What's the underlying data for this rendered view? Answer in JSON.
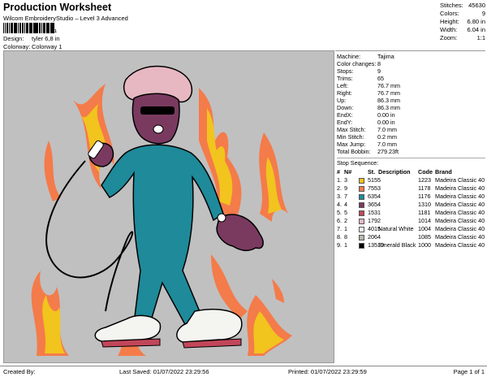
{
  "header": {
    "title": "Production Worksheet",
    "subtitle": "Wilcom EmbroideryStudio – Level 3 Advanced",
    "barcode_digit": "1",
    "design_label": "Design:",
    "design_value": "tyler 6,8 in",
    "colorway_label": "Colorway:",
    "colorway_value": "Colorway 1"
  },
  "top_stats": [
    {
      "label": "Stitches:",
      "value": "45630"
    },
    {
      "label": "Colors:",
      "value": "9"
    },
    {
      "label": "Height:",
      "value": "6.80 in"
    },
    {
      "label": "Width:",
      "value": "6.04 in"
    },
    {
      "label": "Zoom:",
      "value": "1:1"
    }
  ],
  "machine_info": [
    {
      "label": "Machine:",
      "value": "Tajima"
    },
    {
      "label": "Color changes:",
      "value": "8"
    },
    {
      "label": "Stops:",
      "value": "9"
    },
    {
      "label": "Trims:",
      "value": "65"
    },
    {
      "label": "Left:",
      "value": "76.7 mm"
    },
    {
      "label": "Right:",
      "value": "76.7 mm"
    },
    {
      "label": "Up:",
      "value": "86.3 mm"
    },
    {
      "label": "Down:",
      "value": "86.3 mm"
    },
    {
      "label": "EndX:",
      "value": "0.00 in"
    },
    {
      "label": "EndY:",
      "value": "0.00 in"
    },
    {
      "label": "Max Stitch:",
      "value": "7.0 mm"
    },
    {
      "label": "Min Stitch:",
      "value": "0.2 mm"
    },
    {
      "label": "Max Jump:",
      "value": "7.0 mm"
    },
    {
      "label": "Total Bobbin:",
      "value": "279.23ft"
    }
  ],
  "stop_sequence": {
    "title": "Stop Sequence:",
    "headers": {
      "stop": "#",
      "n": "N#",
      "st": "St.",
      "description": "Description",
      "code": "Code",
      "brand": "Brand"
    },
    "rows": [
      {
        "stop": "1.",
        "n": "3",
        "color": "#f2c41e",
        "st": "5155",
        "description": "",
        "code": "1223",
        "brand": "Madeira Classic 40"
      },
      {
        "stop": "2.",
        "n": "9",
        "color": "#f47b4a",
        "st": "7553",
        "description": "",
        "code": "1178",
        "brand": "Madeira Classic 40"
      },
      {
        "stop": "3.",
        "n": "7",
        "color": "#1e8a9a",
        "st": "6354",
        "description": "",
        "code": "1176",
        "brand": "Madeira Classic 40"
      },
      {
        "stop": "4.",
        "n": "4",
        "color": "#7a3a60",
        "st": "3654",
        "description": "",
        "code": "1310",
        "brand": "Madeira Classic 40"
      },
      {
        "stop": "5.",
        "n": "5",
        "color": "#c2465a",
        "st": "1531",
        "description": "",
        "code": "1181",
        "brand": "Madeira Classic 40"
      },
      {
        "stop": "6.",
        "n": "2",
        "color": "#e8b8c2",
        "st": "1792",
        "description": "",
        "code": "1014",
        "brand": "Madeira Classic 40"
      },
      {
        "stop": "7.",
        "n": "1",
        "color": "#f4f4f0",
        "st": "4015",
        "description": "Natural White",
        "code": "1004",
        "brand": "Madeira Classic 40"
      },
      {
        "stop": "8.",
        "n": "8",
        "color": "#b8b8b0",
        "st": "2064",
        "description": "",
        "code": "1085",
        "brand": "Madeira Classic 40"
      },
      {
        "stop": "9.",
        "n": "1",
        "color": "#000000",
        "st": "13510",
        "description": "Emerald Black",
        "code": "1000",
        "brand": "Madeira Classic 40"
      }
    ]
  },
  "footer": {
    "created_by": "Created By:",
    "last_saved": "Last Saved: 01/07/2022 23:29:56",
    "printed": "Printed: 01/07/2022 23:29:59",
    "page": "Page 1 of 1"
  }
}
